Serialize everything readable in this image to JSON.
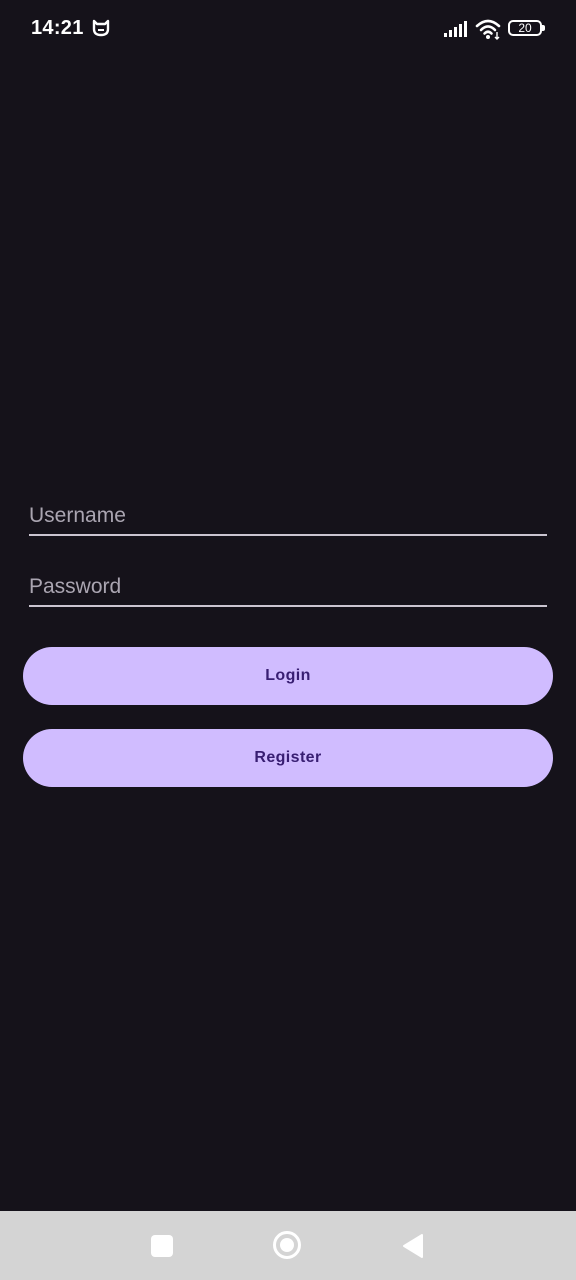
{
  "status_bar": {
    "time": "14:21",
    "battery_level": "20",
    "icons": [
      "mi-icon",
      "signal-icon",
      "wifi-icon",
      "battery-icon"
    ]
  },
  "login_form": {
    "username_placeholder": "Username",
    "username_value": "",
    "password_placeholder": "Password",
    "password_value": "",
    "login_label": "Login",
    "register_label": "Register"
  },
  "nav_bar": {
    "icons": [
      "recents-icon",
      "home-icon",
      "back-icon"
    ]
  },
  "colors": {
    "background": "#15121a",
    "button": "#d0bcff",
    "button_text": "#381e72",
    "underline": "#cac4d0",
    "nav_bar": "#d4d4d4"
  }
}
